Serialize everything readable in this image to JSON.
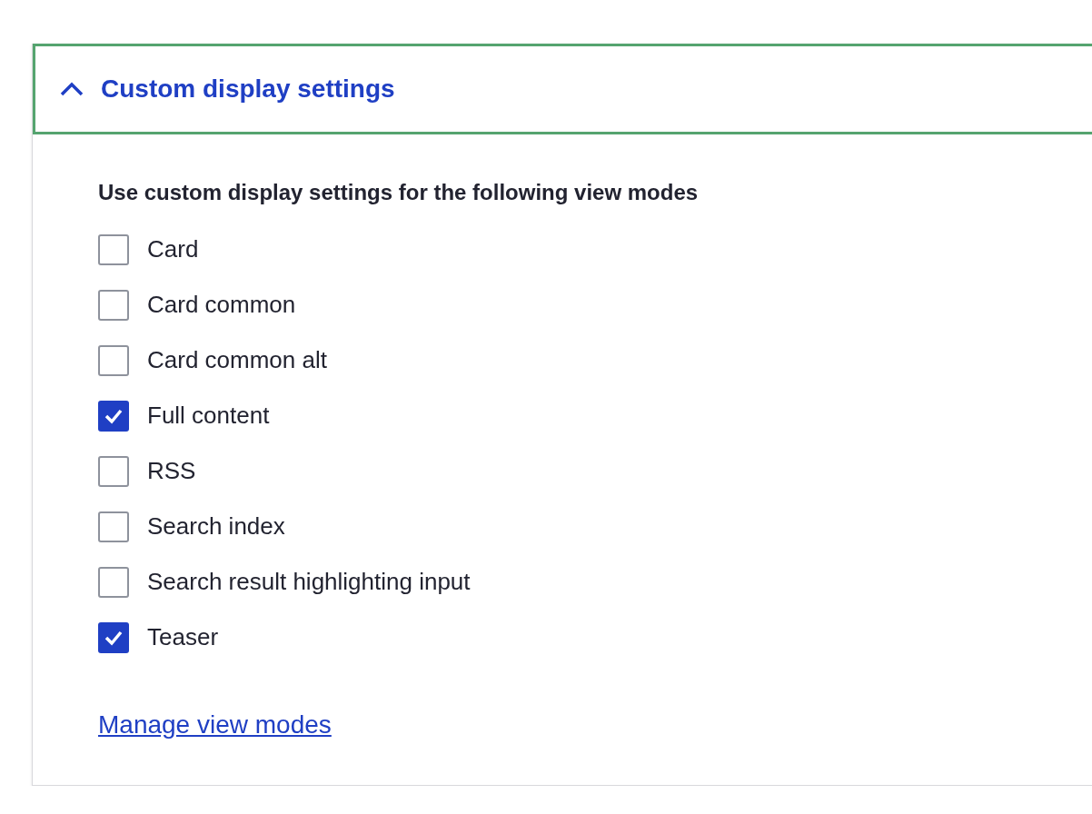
{
  "details": {
    "title": "Custom display settings",
    "expanded": true,
    "legend": "Use custom display settings for the following view modes",
    "options": [
      {
        "label": "Card",
        "checked": false
      },
      {
        "label": "Card common",
        "checked": false
      },
      {
        "label": "Card common alt",
        "checked": false
      },
      {
        "label": "Full content",
        "checked": true
      },
      {
        "label": "RSS",
        "checked": false
      },
      {
        "label": "Search index",
        "checked": false
      },
      {
        "label": "Search result highlighting input",
        "checked": false
      },
      {
        "label": "Teaser",
        "checked": true
      }
    ],
    "link": "Manage view modes"
  }
}
